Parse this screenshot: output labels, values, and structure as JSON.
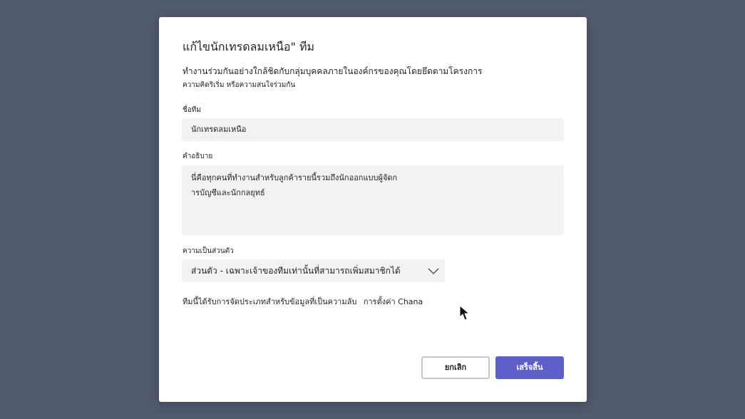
{
  "dialog": {
    "title": "แก้ไขนักเทรดลมเหนือ\" ทีม",
    "description_line1": "ทำงานร่วมกันอย่างใกล้ชิดกับกลุ่มบุคคลภายในองค์กรของคุณโดยยึดตามโครงการ",
    "description_line2": "ความคิดริเริ่ม หรือความสนใจร่วมกัน"
  },
  "team_name": {
    "label": "ชื่อทีม",
    "value": "นักเทรดลมเหนือ"
  },
  "team_description": {
    "label": "คำอธิบาย",
    "line1": "นี่คือทุกคนที่ทำงานสำหรับลูกค้ารายนี้รวมถึงนักออกแบบผู้จัดก",
    "line2": "ารบัญชีและนักกลยุทธ์"
  },
  "privacy": {
    "label": "ความเป็นส่วนตัว",
    "selected": "ส่วนตัว - เฉพาะเจ้าของทีมเท่านั้นที่สามารถเพิ่มสมาชิกได้",
    "icon": "chevron-down-icon"
  },
  "classification_note": {
    "text": "ทีมนี้ได้รับการจัดประเภทสำหรับข้อมูลที่เป็นความลับ",
    "link": "การตั้งค่า Chana"
  },
  "buttons": {
    "cancel": "ยกเลิก",
    "done": "เสร็จสิ้น"
  },
  "colors": {
    "accent": "#5b5fc7",
    "backdrop": "#525a6e",
    "field_bg": "#f1f2f3"
  }
}
